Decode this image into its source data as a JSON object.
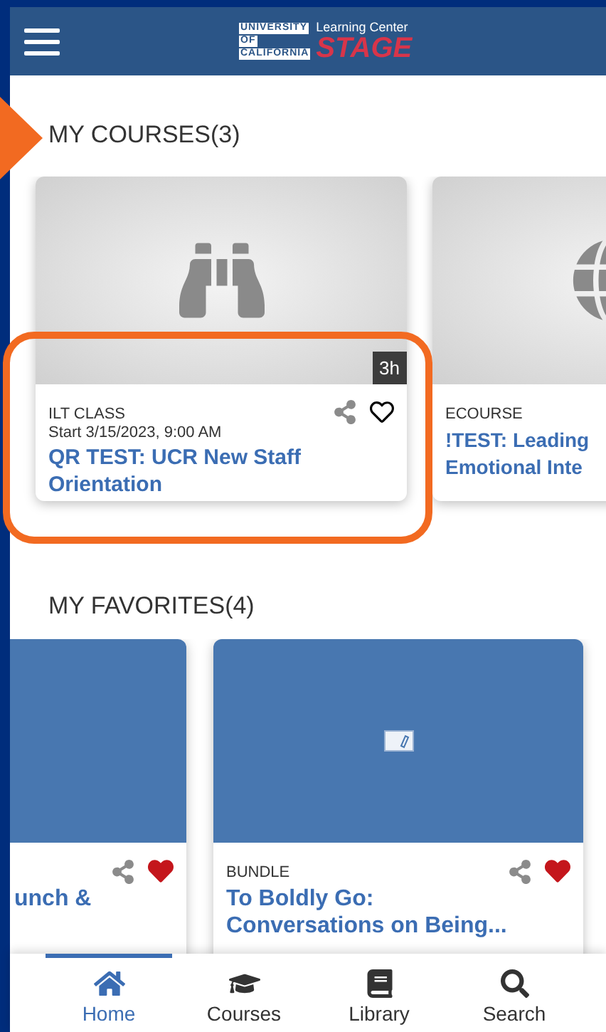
{
  "header": {
    "logo_lines": [
      "UNIVERSITY",
      "OF",
      "CALIFORNIA"
    ],
    "logo_subtitle": "Learning Center",
    "logo_title": "STAGE"
  },
  "sections": [
    {
      "title": "MY COURSES(3)",
      "cards": [
        {
          "kind": "binoculars",
          "duration": "3h",
          "type": "ILT CLASS",
          "start": "Start 3/15/2023, 9:00 AM",
          "title": "QR TEST: UCR New Staff Orientation",
          "favorite": false
        },
        {
          "kind": "globe",
          "type": "ECOURSE",
          "title": "!TEST: Leading Emotional Inte"
        }
      ]
    },
    {
      "title": "MY FAVORITES(4)",
      "cards": [
        {
          "kind": "blank",
          "title": "unch &",
          "favorite": true
        },
        {
          "kind": "pencil",
          "type": "BUNDLE",
          "title": "To Boldly Go: Conversations on Being...",
          "favorite": true
        }
      ]
    }
  ],
  "nav": [
    {
      "label": "Home",
      "selected": true
    },
    {
      "label": "Courses",
      "selected": false
    },
    {
      "label": "Library",
      "selected": false
    },
    {
      "label": "Search",
      "selected": false
    }
  ]
}
